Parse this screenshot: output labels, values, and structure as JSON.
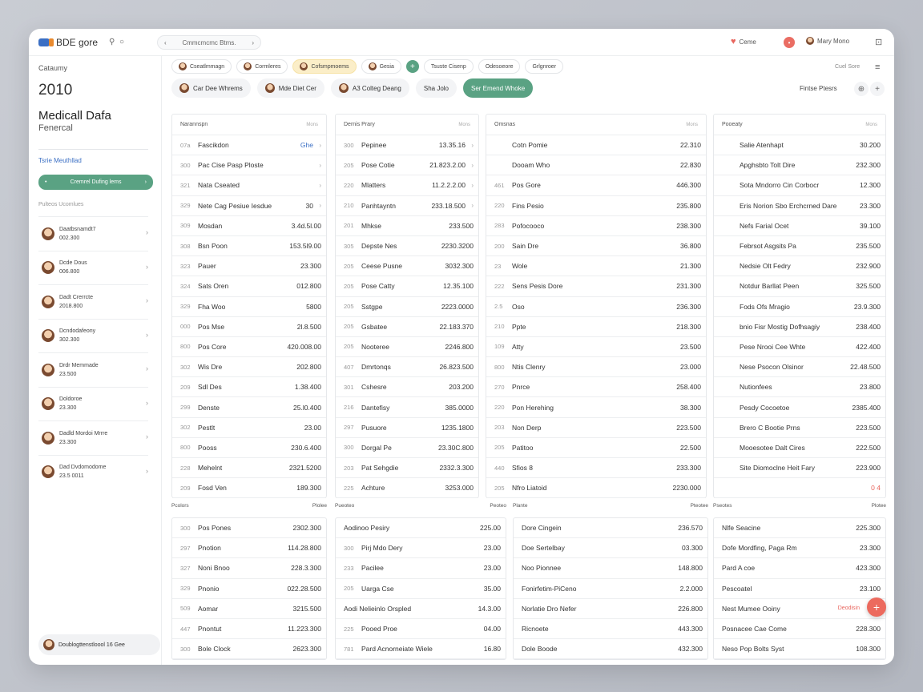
{
  "topbar": {
    "app_name": "BDE gore",
    "address": "Cmmcmcmc Btms.",
    "right_label": "Ceme",
    "user_name": "Mary Mono"
  },
  "sidebar": {
    "title": "Cataumy",
    "year": "2010",
    "heading": "Medicall Dafa",
    "subheading": "Fenercal",
    "link": "Tsrie Meuthllad",
    "button": "Cremrel Dufing lems",
    "caption": "Pulteos Ucomlues",
    "contacts": [
      {
        "name": "Daatbsnamdt7",
        "id": "002.300"
      },
      {
        "name": "Dcde Dous",
        "id": "006.800"
      },
      {
        "name": "Dadt Crerrcte",
        "id": "2018.800"
      },
      {
        "name": "Dcndodafeony",
        "id": "302.300"
      },
      {
        "name": "Drdr Memmade",
        "id": "23.500"
      },
      {
        "name": "Doldoroe",
        "id": "23.300"
      },
      {
        "name": "Dadld Mordoi Mrrre",
        "id": "23.300"
      },
      {
        "name": "Dad Dvdomodome",
        "id": "23.5 0011"
      }
    ],
    "footer": "Doublogttenstloool 16 Gee"
  },
  "chips": [
    "Cseatlmmagn",
    "Cormleres",
    "Cofsmpmoems",
    "Gesia",
    "Tsuste Cisenp",
    "Odesoeore",
    "Grlgnroer"
  ],
  "top_right_small": "Cuel Sore",
  "filters": [
    "Car Dee Whrems",
    "Mde Diet Cer",
    "A3 Colteg Deang",
    "Sha Jolo",
    "Ser Emend Whoke"
  ],
  "filter_right": "Fintse Ptesrs",
  "tables": [
    {
      "header": "Narannspn",
      "header_right": "Mons",
      "rows": [
        {
          "c": "07a",
          "n": "Fascikdon",
          "v": "Ghe",
          "blue": true
        },
        {
          "c": "300",
          "n": "Pac Cise Pasp Ploste",
          "v": ""
        },
        {
          "c": "321",
          "n": "Nata Cseated",
          "v": ""
        },
        {
          "c": "329",
          "n": "Nete Cag Pesiue Iesdue",
          "v": "30"
        },
        {
          "c": "309",
          "n": "Mosdan",
          "v": "3.4d.5l.00"
        },
        {
          "c": "308",
          "n": "Bsn Poon",
          "v": "153.5l9.00"
        },
        {
          "c": "323",
          "n": "Pauer",
          "v": "23.300"
        },
        {
          "c": "324",
          "n": "Sats Oren",
          "v": "012.800"
        },
        {
          "c": "329",
          "n": "Fha Woo",
          "v": "5800"
        },
        {
          "c": "000",
          "n": "Pos Mse",
          "v": "2l.8.500"
        },
        {
          "c": "800",
          "n": "Pos Core",
          "v": "420.008.00"
        },
        {
          "c": "302",
          "n": "Wis Dre",
          "v": "202.800"
        },
        {
          "c": "209",
          "n": "Sdl Des",
          "v": "1.38.400"
        },
        {
          "c": "299",
          "n": "Denste",
          "v": "25.l0.400"
        },
        {
          "c": "302",
          "n": "Pestlt",
          "v": "23.00"
        },
        {
          "c": "800",
          "n": "Pooss",
          "v": "230.6.400"
        },
        {
          "c": "228",
          "n": "Mehelnt",
          "v": "2321.5200"
        },
        {
          "c": "209",
          "n": "Fosd Ven",
          "v": "189.300"
        }
      ]
    },
    {
      "header": "Dernis Prary",
      "header_right": "Mons",
      "rows": [
        {
          "c": "300",
          "n": "Pepinee",
          "v": "13.35.16"
        },
        {
          "c": "205",
          "n": "Pose Cotie",
          "v": "21.823.2.00"
        },
        {
          "c": "220",
          "n": "Mlatters",
          "v": "11.2.2.2.00"
        },
        {
          "c": "210",
          "n": "Panhtayntn",
          "v": "233.18.500"
        },
        {
          "c": "201",
          "n": "Mhkse",
          "v": "233.500"
        },
        {
          "c": "305",
          "n": "Depste Nes",
          "v": "2230.3200"
        },
        {
          "c": "205",
          "n": "Ceese Pusne",
          "v": "3032.300"
        },
        {
          "c": "205",
          "n": "Pose Catty",
          "v": "12.35.100"
        },
        {
          "c": "205",
          "n": "Sstgpe",
          "v": "2223.0000"
        },
        {
          "c": "205",
          "n": "Gsbatee",
          "v": "22.183.370"
        },
        {
          "c": "205",
          "n": "Nooteree",
          "v": "2246.800"
        },
        {
          "c": "407",
          "n": "Dmrtonqs",
          "v": "26.823.500"
        },
        {
          "c": "301",
          "n": "Cshesre",
          "v": "203.200"
        },
        {
          "c": "216",
          "n": "Dantefisy",
          "v": "385.0000"
        },
        {
          "c": "297",
          "n": "Pusuore",
          "v": "1235.1800"
        },
        {
          "c": "300",
          "n": "Dorgal Pe",
          "v": "23.30C.800"
        },
        {
          "c": "203",
          "n": "Pat Sehgdie",
          "v": "2332.3.300"
        },
        {
          "c": "225",
          "n": "Achture",
          "v": "3253.000"
        }
      ]
    },
    {
      "header": "Omsnas",
      "header_right": "Mons",
      "rows": [
        {
          "c": "",
          "n": "Cotn Pomie",
          "v": "22.310"
        },
        {
          "c": "",
          "n": "Dooam Who",
          "v": "22.830"
        },
        {
          "c": "461",
          "n": "Pos Gore",
          "v": "446.300"
        },
        {
          "c": "220",
          "n": "Fins Pesio",
          "v": "235.800"
        },
        {
          "c": "283",
          "n": "Pofocooco",
          "v": "238.300"
        },
        {
          "c": "200",
          "n": "Sain Dre",
          "v": "36.800"
        },
        {
          "c": "23",
          "n": "Wole",
          "v": "21.300"
        },
        {
          "c": "222",
          "n": "Sens Pesis Dore",
          "v": "231.300"
        },
        {
          "c": "2.5",
          "n": "Oso",
          "v": "236.300"
        },
        {
          "c": "210",
          "n": "Ppte",
          "v": "218.300"
        },
        {
          "c": "109",
          "n": "Atty",
          "v": "23.500"
        },
        {
          "c": "800",
          "n": "Ntis Clenry",
          "v": "23.000"
        },
        {
          "c": "270",
          "n": "Pnrce",
          "v": "258.400"
        },
        {
          "c": "220",
          "n": "Pon Herehing",
          "v": "38.300"
        },
        {
          "c": "203",
          "n": "Non Derp",
          "v": "223.500"
        },
        {
          "c": "205",
          "n": "Patitoo",
          "v": "22.500"
        },
        {
          "c": "440",
          "n": "Sfios 8",
          "v": "233.300"
        },
        {
          "c": "205",
          "n": "Nfro Liatoid",
          "v": "2230.000"
        }
      ]
    },
    {
      "header": "Pooeaty",
      "header_right": "Mons",
      "rows": [
        {
          "c": "",
          "n": "Salie Atenhapt",
          "v": "30.200"
        },
        {
          "c": "",
          "n": "Apghsbto Tolt Dire",
          "v": "232.300"
        },
        {
          "c": "",
          "n": "Sota Mndorro Cin Corbocr",
          "v": "12.300"
        },
        {
          "c": "",
          "n": "Eris Norion Sbo Erchcrned Dare",
          "v": "23.300"
        },
        {
          "c": "",
          "n": "Nefs Farial Ocet",
          "v": "39.100"
        },
        {
          "c": "",
          "n": "Febrsot Asgsits Pa",
          "v": "235.500"
        },
        {
          "c": "",
          "n": "Nedsie Olt Fedry",
          "v": "232.900"
        },
        {
          "c": "",
          "n": "Notdur Barllat Peen",
          "v": "325.500"
        },
        {
          "c": "",
          "n": "Fods Ofs Mragio",
          "v": "23.9.300"
        },
        {
          "c": "",
          "n": "bnio Fisr Mostig Dofhsagiy",
          "v": "238.400"
        },
        {
          "c": "",
          "n": "Pese Nrooi Cee Whte",
          "v": "422.400"
        },
        {
          "c": "",
          "n": "Nese Psocon Olsinor",
          "v": "22.48.500"
        },
        {
          "c": "",
          "n": "Nutionfees",
          "v": "23.800"
        },
        {
          "c": "",
          "n": "Pesdy Cocoetoe",
          "v": "2385.400"
        },
        {
          "c": "",
          "n": "Brero C Bootie Prns",
          "v": "223.500"
        },
        {
          "c": "",
          "n": "Mooesotee Dalt Cires",
          "v": "222.500"
        },
        {
          "c": "",
          "n": "Site Diomoclne Heit Fary",
          "v": "223.900"
        },
        {
          "c": "",
          "n": "",
          "v": "0 4",
          "red": true
        }
      ]
    }
  ],
  "bottom_heads": [
    {
      "l": "Pcolors",
      "r": "Plolee"
    },
    {
      "l": "Pueoteo",
      "r": "Peoteo"
    },
    {
      "l": "Plante",
      "r": "Pteotee"
    },
    {
      "l": "Pseotes",
      "r": "Plotee"
    }
  ],
  "bottom_tables": [
    {
      "rows": [
        {
          "c": "300",
          "n": "Pos Pones",
          "v": "2302.300"
        },
        {
          "c": "297",
          "n": "Pnotion",
          "v": "114.28.800"
        },
        {
          "c": "327",
          "n": "Noni Bnoo",
          "v": "228.3.300"
        },
        {
          "c": "329",
          "n": "Pnonio",
          "v": "022.28.500"
        },
        {
          "c": "509",
          "n": "Aomar",
          "v": "3215.500"
        },
        {
          "c": "447",
          "n": "Pnontut",
          "v": "11.223.300"
        },
        {
          "c": "300",
          "n": "Bole Clock",
          "v": "2623.300"
        }
      ]
    },
    {
      "rows": [
        {
          "c": "",
          "n": "Aodinoo Pesiry",
          "v": "225.00"
        },
        {
          "c": "300",
          "n": "Pirj Mdo Dery",
          "v": "23.00"
        },
        {
          "c": "233",
          "n": "Pacilee",
          "v": "23.00"
        },
        {
          "c": "205",
          "n": "Uarga Cse",
          "v": "35.00"
        },
        {
          "c": "",
          "n": "Aodi Nelieinlo Orspled",
          "v": "14.3.00"
        },
        {
          "c": "225",
          "n": "Pooed Proe",
          "v": "04.00"
        },
        {
          "c": "781",
          "n": "Pard Acnorneiate Wiele",
          "v": "16.80"
        }
      ]
    },
    {
      "rows": [
        {
          "c": "",
          "n": "Dore Cingein",
          "v": "236.570"
        },
        {
          "c": "",
          "n": "Doe Sertelbay",
          "v": "03.300"
        },
        {
          "c": "",
          "n": "Noo Pionnee",
          "v": "148.800"
        },
        {
          "c": "",
          "n": "Fonirfetim-PiCeno",
          "v": "2.2.000"
        },
        {
          "c": "",
          "n": "Norlatie Dro Nefer",
          "v": "226.800"
        },
        {
          "c": "",
          "n": "Ricnoete",
          "v": "443.300"
        },
        {
          "c": "",
          "n": "Dole Boode",
          "v": "432.300"
        }
      ]
    },
    {
      "rows": [
        {
          "c": "",
          "n": "Nlfe Seacine",
          "v": "225.300"
        },
        {
          "c": "",
          "n": "Dofe Mordfing, Paga Rm",
          "v": "23.300"
        },
        {
          "c": "",
          "n": "Pard A coe",
          "v": "423.300"
        },
        {
          "c": "",
          "n": "Pescoatel",
          "v": "23.100"
        },
        {
          "c": "",
          "n": "Nest Mumee Ooiny",
          "v": "Deodisin",
          "red": true
        },
        {
          "c": "",
          "n": "Posnacee Cae Come",
          "v": "228.300"
        },
        {
          "c": "",
          "n": "Neso Pop Bolts Syst",
          "v": "108.300"
        }
      ]
    }
  ],
  "fab_symbol": "+"
}
